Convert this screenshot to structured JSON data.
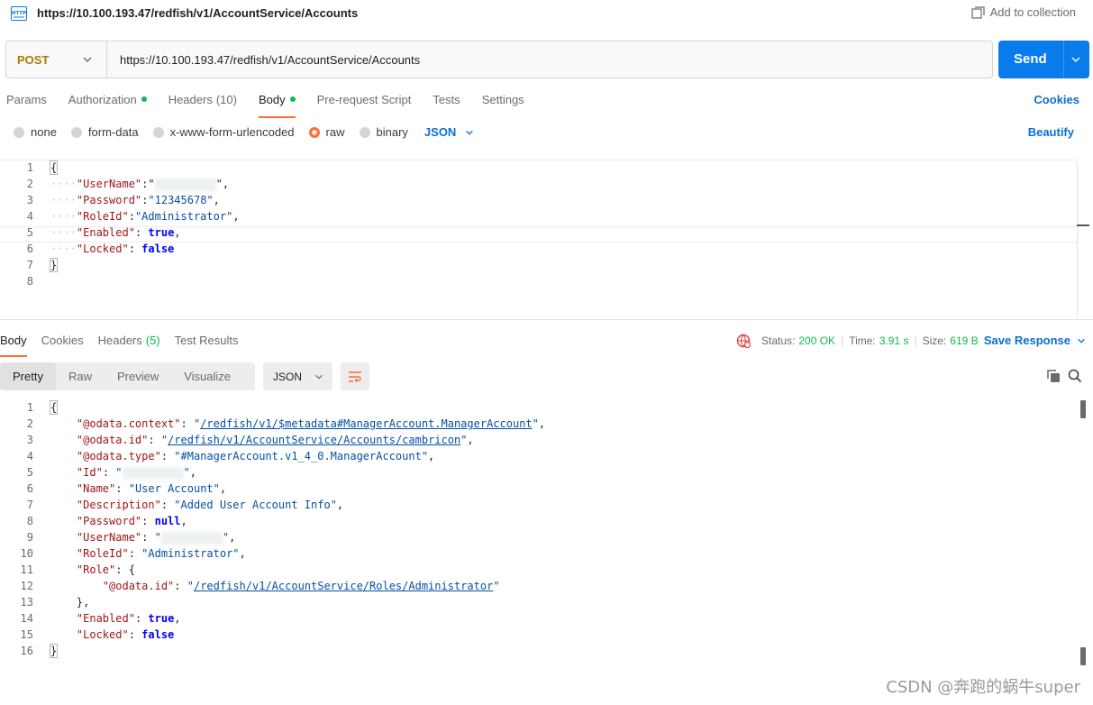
{
  "titlebar": {
    "badge": "HTTP",
    "title": "https://10.100.193.47/redfish/v1/AccountService/Accounts",
    "add_to_collection": "Add to collection"
  },
  "request": {
    "method": "POST",
    "url": "https://10.100.193.47/redfish/v1/AccountService/Accounts",
    "send_label": "Send",
    "tabs": [
      {
        "label": "Params",
        "count": "",
        "dot": false
      },
      {
        "label": "Authorization",
        "count": "",
        "dot": true
      },
      {
        "label": "Headers",
        "count": "(10)",
        "dot": false
      },
      {
        "label": "Body",
        "count": "",
        "dot": true
      },
      {
        "label": "Pre-request Script",
        "count": "",
        "dot": false
      },
      {
        "label": "Tests",
        "count": "",
        "dot": false
      },
      {
        "label": "Settings",
        "count": "",
        "dot": false
      }
    ],
    "active_tab": "Body",
    "cookies_label": "Cookies",
    "body_types": [
      "none",
      "form-data",
      "x-www-form-urlencoded",
      "raw",
      "binary"
    ],
    "selected_body_type": "raw",
    "body_format": "JSON",
    "beautify_label": "Beautify",
    "body_lines": [
      "{",
      "\"UserName\":\"[redacted]\",",
      "\"Password\":\"12345678\",",
      "\"RoleId\":\"Administrator\",",
      "\"Enabled\": true,",
      "\"Locked\": false",
      "}",
      ""
    ],
    "line_numbers": [
      "1",
      "2",
      "3",
      "4",
      "5",
      "6",
      "7",
      "8"
    ]
  },
  "response": {
    "tabs": [
      {
        "label": "Body",
        "count": ""
      },
      {
        "label": "Cookies",
        "count": ""
      },
      {
        "label": "Headers",
        "count": "(5)"
      },
      {
        "label": "Test Results",
        "count": ""
      }
    ],
    "active_tab": "Body",
    "status_label": "Status:",
    "status_value": "200 OK",
    "time_label": "Time:",
    "time_value": "3.91 s",
    "size_label": "Size:",
    "size_value": "619 B",
    "save_response_label": "Save Response",
    "views": [
      "Pretty",
      "Raw",
      "Preview",
      "Visualize"
    ],
    "active_view": "Pretty",
    "format": "JSON",
    "line_numbers": [
      "1",
      "2",
      "3",
      "4",
      "5",
      "6",
      "7",
      "8",
      "9",
      "10",
      "11",
      "12",
      "13",
      "14",
      "15",
      "16"
    ],
    "body": {
      "odata_context_key": "\"@odata.context\"",
      "odata_context_val": "/redfish/v1/$metadata#ManagerAccount.ManagerAccount",
      "odata_id_key": "\"@odata.id\"",
      "odata_id_val": "/redfish/v1/AccountService/Accounts/cambricon",
      "odata_type_key": "\"@odata.type\"",
      "odata_type_val": "\"#ManagerAccount.v1_4_0.ManagerAccount\"",
      "id_key": "\"Id\"",
      "name_key": "\"Name\"",
      "name_val": "\"User Account\"",
      "desc_key": "\"Description\"",
      "desc_val": "\"Added User Account Info\"",
      "password_key": "\"Password\"",
      "password_val": "null",
      "username_key": "\"UserName\"",
      "roleid_key": "\"RoleId\"",
      "roleid_val": "\"Administrator\"",
      "role_key": "\"Role\"",
      "role_odata_id_key": "\"@odata.id\"",
      "role_odata_id_val": "/redfish/v1/AccountService/Roles/Administrator",
      "enabled_key": "\"Enabled\"",
      "enabled_val": "true",
      "locked_key": "\"Locked\"",
      "locked_val": "false"
    }
  },
  "watermark": "CSDN @奔跑的蜗牛super",
  "colors": {
    "accent": "#ff6c37",
    "primary": "#097bed",
    "link": "#0b6fcf",
    "success": "#0cbb52",
    "method_post": "#ad7a03"
  }
}
